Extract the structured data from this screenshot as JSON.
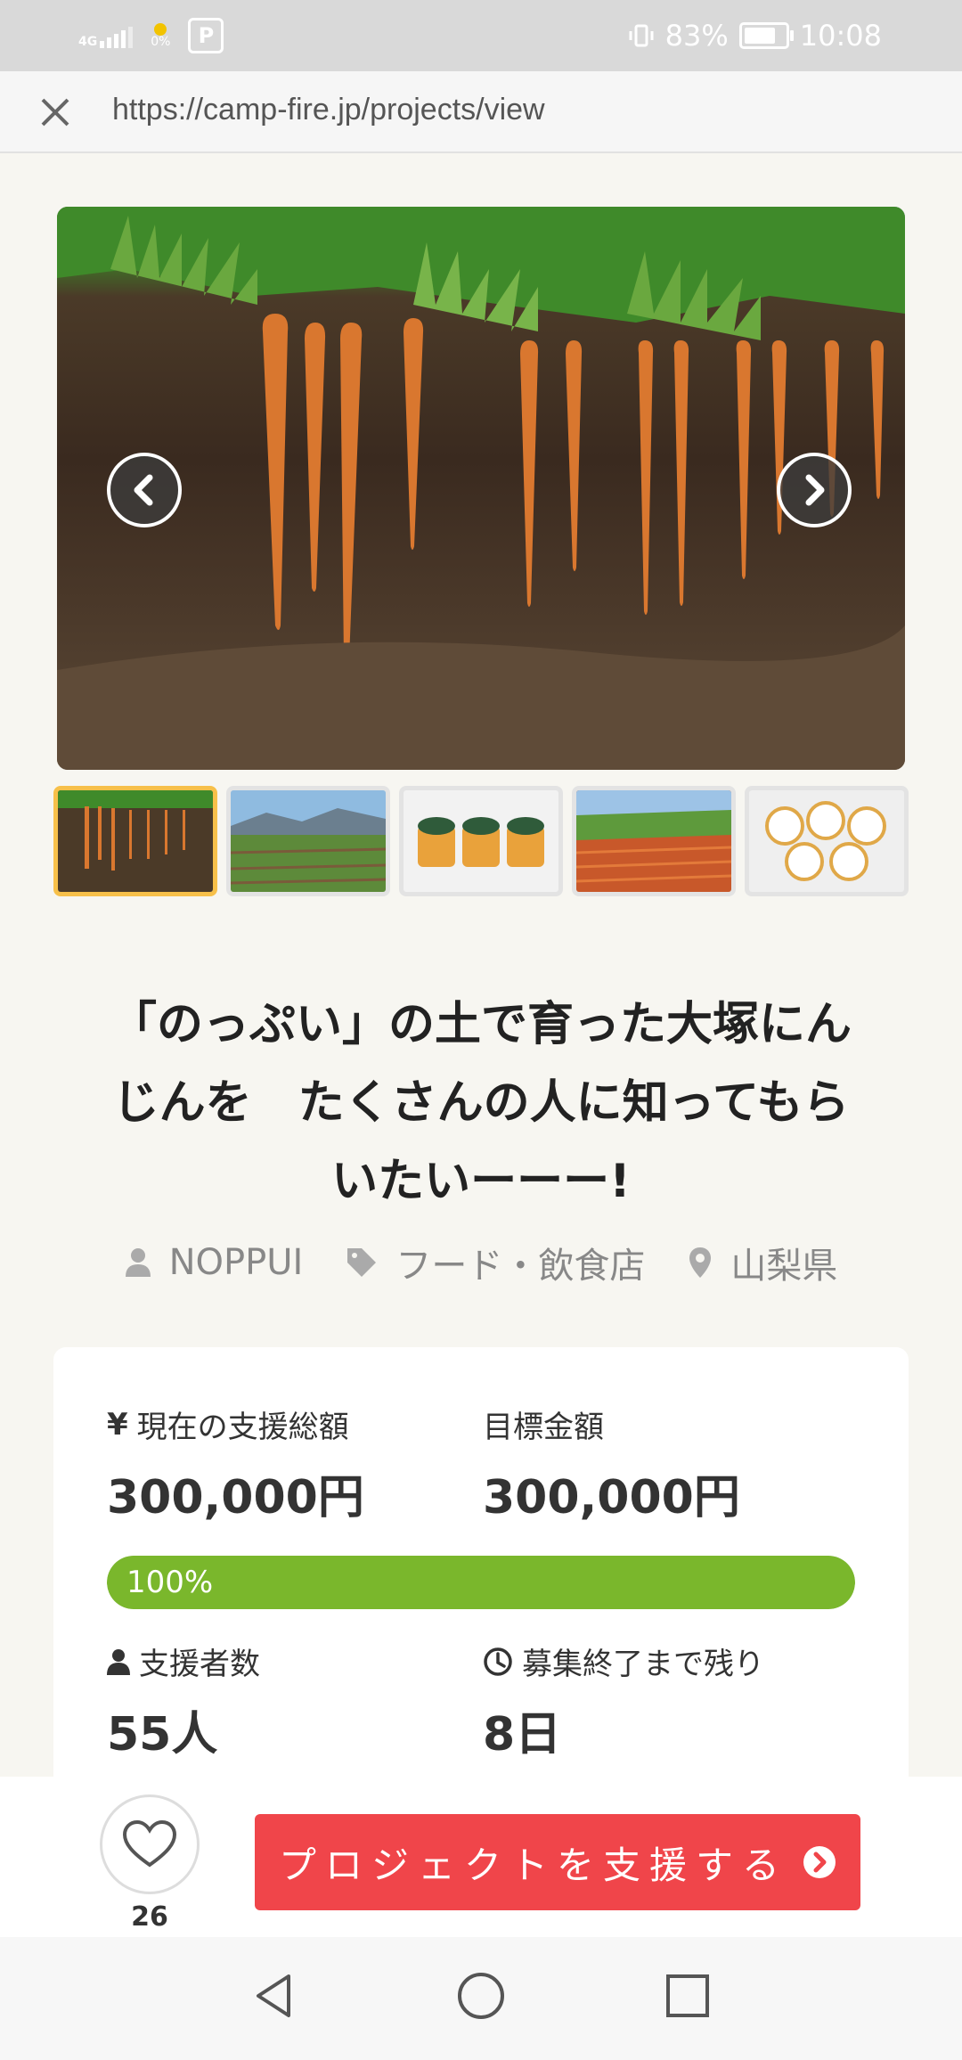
{
  "status_bar": {
    "network": "4G",
    "battery_pct": "83%",
    "time": "10:08",
    "data_indicator": "0%"
  },
  "browser": {
    "url": "https://camp-fire.jp/projects/view"
  },
  "gallery": {
    "image_count": 5,
    "active_index": 0
  },
  "project": {
    "title_line1": "「のっぷい」の土で育った大塚にん",
    "title_line2": "じんを　たくさんの人に知ってもら",
    "title_line3": "いたいーーー!",
    "owner": "NOPPUI",
    "category": "フード・飲食店",
    "location": "山梨県"
  },
  "stats": {
    "current_label": "現在の支援総額",
    "current_value": "300,000円",
    "goal_label": "目標金額",
    "goal_value": "300,000円",
    "progress_text": "100%",
    "progress_value": 1.0,
    "backers_label": "支援者数",
    "backers_value": "55人",
    "remaining_label": "募集終了まで残り",
    "remaining_value": "8日"
  },
  "actions": {
    "like_count": "26",
    "support_label": "プロジェクトを支援する"
  },
  "colors": {
    "accent_red": "#f0454a",
    "progress_green": "#7ab72c",
    "active_thumb_border": "#f7c04a"
  }
}
